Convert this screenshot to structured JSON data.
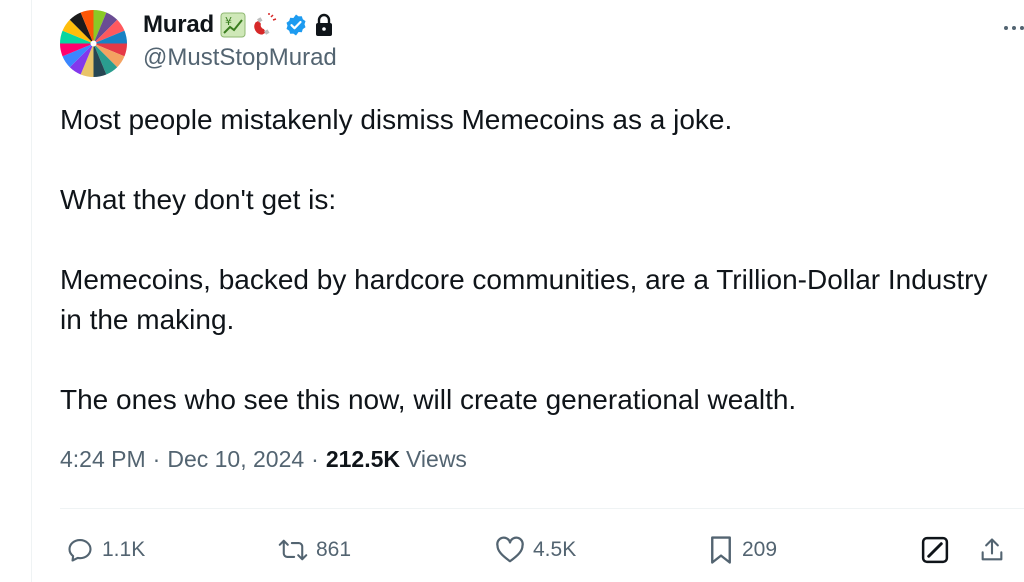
{
  "author": {
    "display_name": "Murad",
    "handle": "@MustStopMurad",
    "badges": [
      "chart-yen-emoji",
      "magnet-emoji",
      "verified-badge",
      "lock-icon"
    ]
  },
  "tweet": {
    "paragraphs": [
      "Most people mistakenly dismiss Memecoins as a joke.",
      "What they don't get is:",
      "Memecoins, backed by hardcore communities, are a Trillion-Dollar Industry in the making.",
      "The ones who see this now, will create generational wealth."
    ]
  },
  "meta": {
    "time": "4:24 PM",
    "separator": "·",
    "date": "Dec 10, 2024",
    "views_count": "212.5K",
    "views_label": "Views"
  },
  "actions": {
    "reply_count": "1.1K",
    "repost_count": "861",
    "like_count": "4.5K",
    "bookmark_count": "209"
  },
  "colors": {
    "text_primary": "#0f1419",
    "text_secondary": "#536471",
    "verified_blue": "#1d9bf0",
    "divider": "#eff3f4"
  }
}
